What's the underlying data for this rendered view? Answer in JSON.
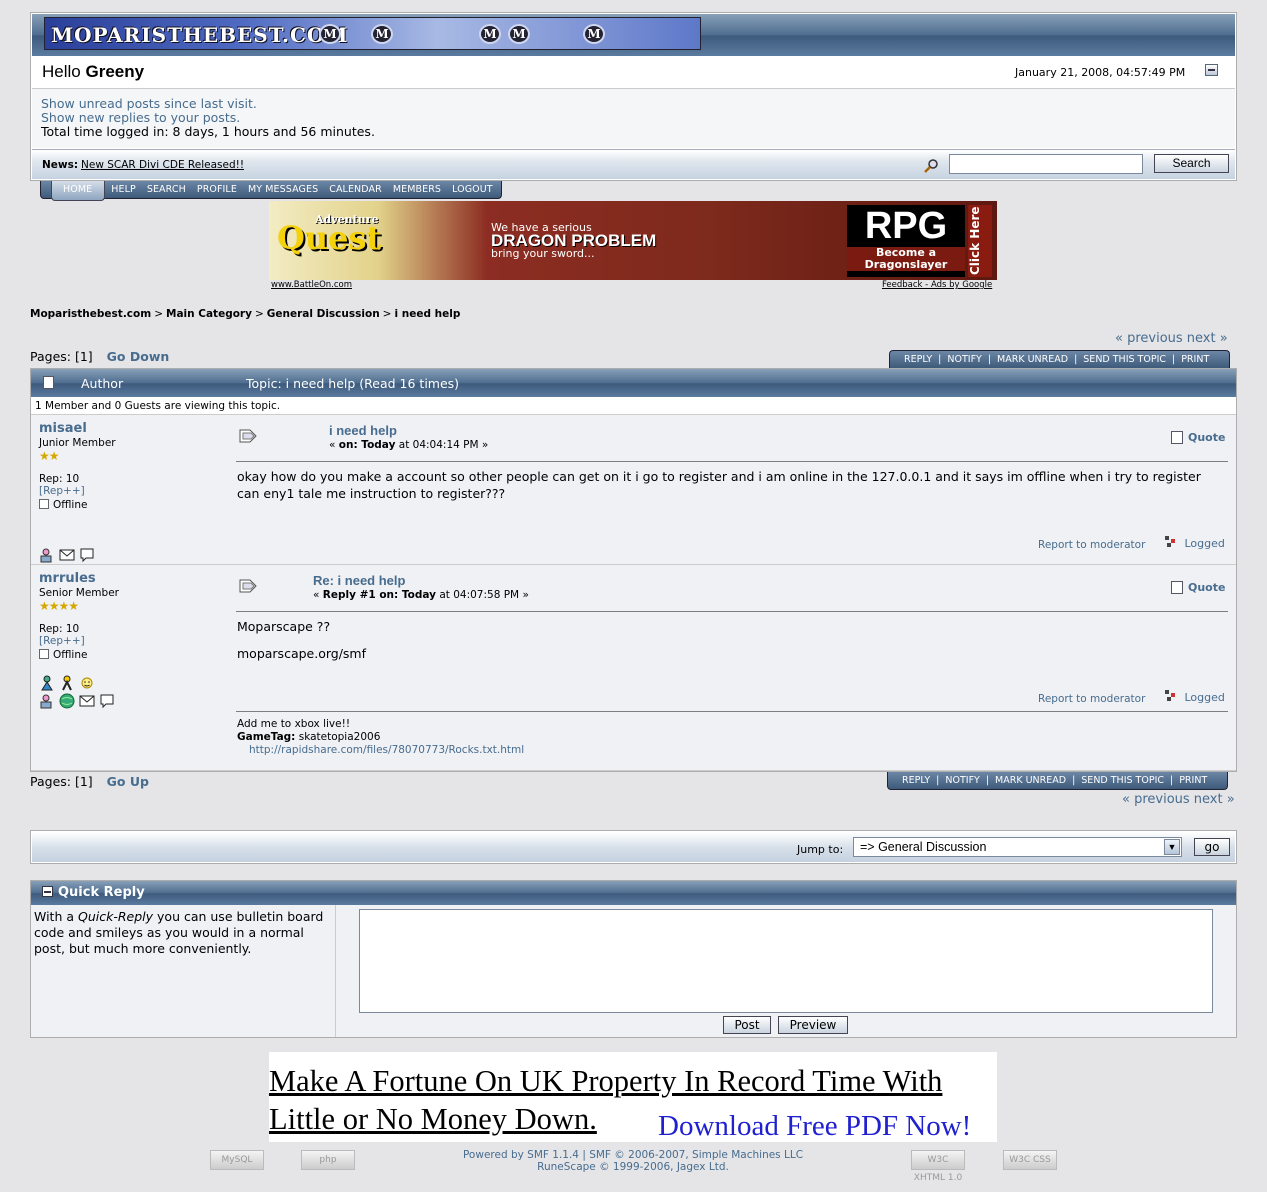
{
  "header": {
    "logo_text": "MOPARISTHEBEST.COM",
    "greeting_prefix": "Hello",
    "username": "Greeny",
    "datetime": "January 21, 2008, 04:57:49 PM",
    "links": [
      "Show unread posts since last visit.",
      "Show new replies to your posts."
    ],
    "time_logged": "Total time logged in: 8 days, 1 hours and 56 minutes.",
    "news_label": "News:",
    "news_text": "New SCAR Divi CDE Released!!",
    "search_button": "Search",
    "search_value": ""
  },
  "nav": [
    "HOME",
    "HELP",
    "SEARCH",
    "PROFILE",
    "MY MESSAGES",
    "CALENDAR",
    "MEMBERS",
    "LOGOUT"
  ],
  "ad_top": {
    "brand_small": "Adventure",
    "brand": "Quest",
    "line1": "We have a serious",
    "line2": "DRAGON PROBLEM",
    "line3": "bring your sword...",
    "rpg": "RPG",
    "rpg_sub": "Become a Dragonslayer",
    "click": "Click Here",
    "foot_left": "www.BattleOn.com",
    "foot_right": "Feedback - Ads by Google"
  },
  "breadcrumb": [
    "Moparisthebest.com",
    "Main Category",
    "General Discussion",
    "i need help"
  ],
  "breadcrumb_sep": ">",
  "prevnext": "« previous next »",
  "pages": {
    "label": "Pages: [1]",
    "go_down": "Go Down",
    "go_up": "Go Up"
  },
  "topic_buttons": [
    "REPLY",
    "NOTIFY",
    "MARK UNREAD",
    "SEND THIS TOPIC",
    "PRINT"
  ],
  "topic": {
    "author_col": "Author",
    "subject_col": "Topic: i need help  (Read 16 times)",
    "viewing": "1 Member and 0 Guests are viewing this topic."
  },
  "posts": [
    {
      "name": "misael",
      "rank": "Junior Member",
      "stars": "★★",
      "rep": "Rep: 10",
      "rep_link": "[Rep++]",
      "status": "Offline",
      "subject": "i need help",
      "date_prefix": "« ",
      "date_bold": "on: Today",
      "date_rest": " at 04:04:14 PM »",
      "quote": "Quote",
      "body": "okay how do you make a account so other people can get on it i go to register and i am online in the 127.0.0.1 and it says im offline when i try to register can eny1 tale me instruction to register???",
      "report": "Report to moderator",
      "logged": "Logged"
    },
    {
      "name": "mrrules",
      "rank": "Senior Member",
      "stars": "★★★★",
      "rep": "Rep: 10",
      "rep_link": "[Rep++]",
      "status": "Offline",
      "subject": "Re: i need help",
      "date_prefix": "« ",
      "date_bold": "Reply #1 on: Today",
      "date_rest": " at 04:07:58 PM »",
      "quote": "Quote",
      "body_line1": "Moparscape ??",
      "body_line2": "moparscape.org/smf",
      "report": "Report to moderator",
      "logged": "Logged",
      "sig_line1": "Add me to xbox live!!",
      "sig_label": "GameTag:",
      "sig_value": " skatetopia2006",
      "sig_link": "http://rapidshare.com/files/78070773/Rocks.txt.html"
    }
  ],
  "jump": {
    "label": "Jump to:",
    "selected": "=> General Discussion",
    "go": "go"
  },
  "quick_reply": {
    "title": "Quick Reply",
    "desc_before": "With a ",
    "desc_em": "Quick-Reply",
    "desc_after": " you can use bulletin board code and smileys as you would in a normal post, but much more conveniently.",
    "post_button": "Post",
    "preview_button": "Preview"
  },
  "ad_bottom": {
    "headline_line1": "Make A Fortune On UK Property In Record Time With",
    "headline_line2": "Little or No Money Down.",
    "cta": "Download Free PDF Now!"
  },
  "footer": {
    "badges": [
      "MySQL",
      "php",
      "W3C XHTML 1.0",
      "W3C CSS"
    ],
    "line1": "Powered by SMF 1.1.4 | SMF © 2006-2007, Simple Machines LLC",
    "line2": "RuneScape © 1999-2006, Jagex Ltd."
  }
}
